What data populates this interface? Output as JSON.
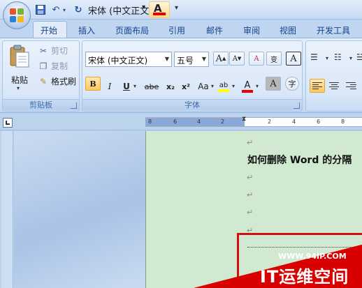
{
  "quick_access": {
    "save_icon": "save-icon",
    "undo_icon": "undo-icon",
    "redo_icon": "redo-icon",
    "font_label": "宋体 (中文正文",
    "font_color_letter": "A",
    "font_color": "#e60000"
  },
  "tabs": [
    {
      "label": "开始",
      "active": true
    },
    {
      "label": "插入"
    },
    {
      "label": "页面布局"
    },
    {
      "label": "引用"
    },
    {
      "label": "邮件"
    },
    {
      "label": "审阅"
    },
    {
      "label": "视图"
    },
    {
      "label": "开发工具"
    }
  ],
  "clipboard": {
    "paste_label": "粘贴",
    "cut_label": "剪切",
    "copy_label": "复制",
    "format_painter_label": "格式刷",
    "group_label": "剪贴板"
  },
  "font_group": {
    "font_name": "宋体 (中文正文)",
    "font_size": "五号",
    "grow_label": "A",
    "shrink_label": "A",
    "phonetic_label": "变",
    "clear_label": "A",
    "bold_label": "B",
    "italic_label": "I",
    "underline_label": "U",
    "strike_label": "abe",
    "subscript_label": "x₂",
    "superscript_label": "x²",
    "case_label": "Aa",
    "highlight_label": "ab",
    "highlight_color": "#ffff00",
    "color_label": "A",
    "color_value": "#e60000",
    "shade_label": "A",
    "enclose_label": "字",
    "group_label": "字体"
  },
  "ruler": {
    "ticks": [
      "8",
      "6",
      "4",
      "2",
      "2",
      "4",
      "6",
      "8"
    ]
  },
  "document": {
    "para_mark": "↵",
    "heading": "如何删除 Word 的分隔"
  },
  "watermark": {
    "url": "WWW.94IP.COM",
    "title": "IT运维空间",
    "color": "#d80000"
  }
}
